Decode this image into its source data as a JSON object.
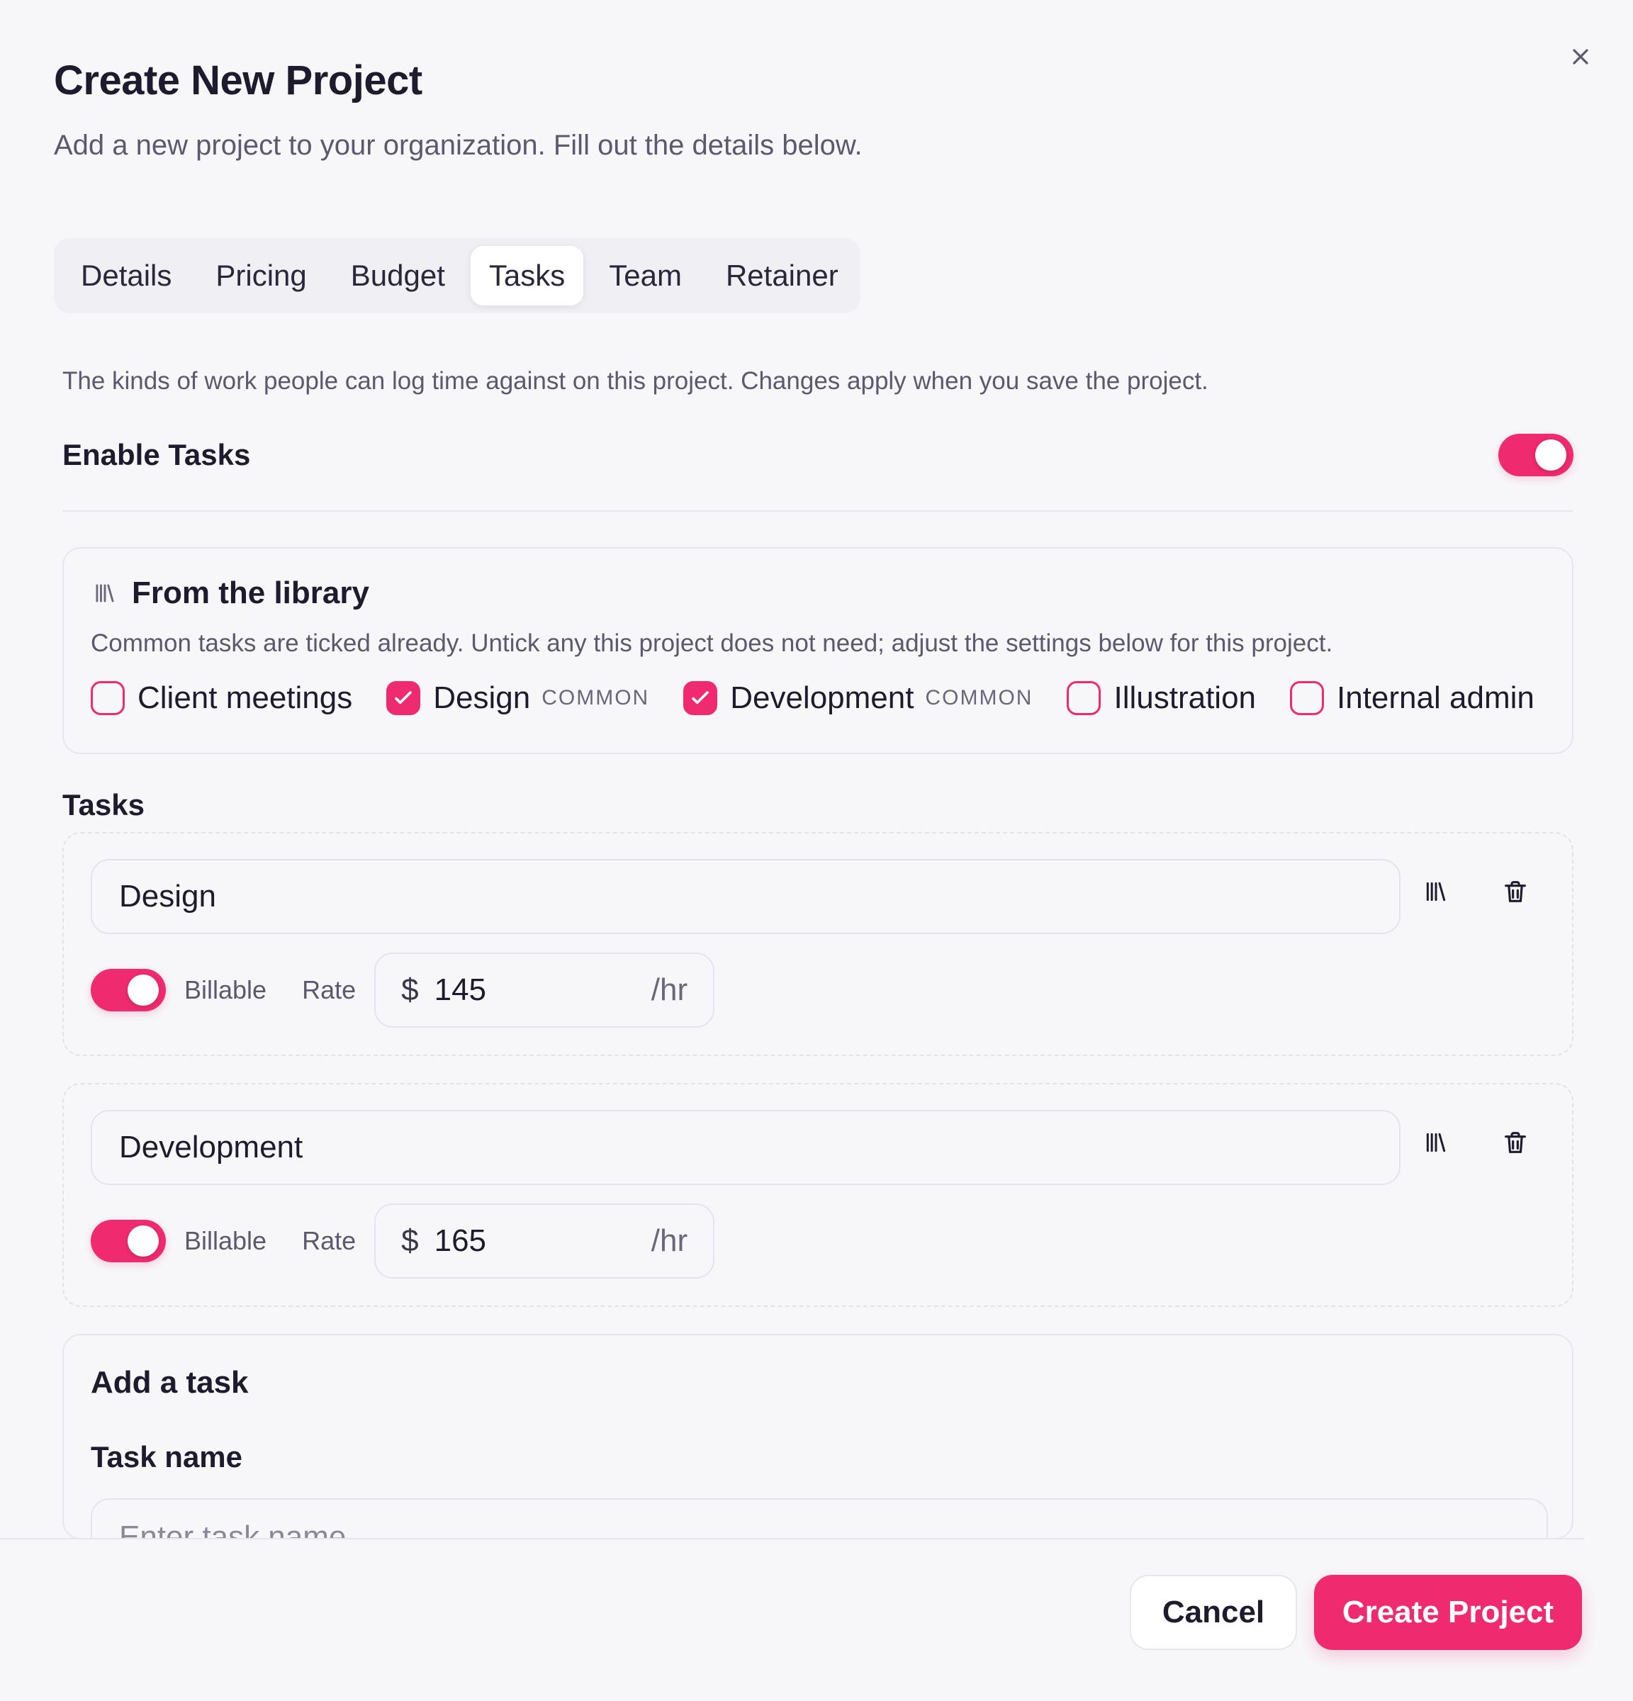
{
  "dialog": {
    "title": "Create New Project",
    "subtitle": "Add a new project to your organization. Fill out the details below.",
    "close_icon": "close-icon"
  },
  "tabs": [
    {
      "label": "Details",
      "active": false
    },
    {
      "label": "Pricing",
      "active": false
    },
    {
      "label": "Budget",
      "active": false
    },
    {
      "label": "Tasks",
      "active": true
    },
    {
      "label": "Team",
      "active": false
    },
    {
      "label": "Retainer",
      "active": false
    }
  ],
  "tasks_tab": {
    "description": "The kinds of work people can log time against on this project. Changes apply when you save the project.",
    "enable_label": "Enable Tasks",
    "enable_on": true,
    "library": {
      "icon": "library-icon",
      "title": "From the library",
      "description": "Common tasks are ticked already. Untick any this project does not need; adjust the settings below for this project.",
      "items": [
        {
          "label": "Client meetings",
          "checked": false,
          "badge": ""
        },
        {
          "label": "Design",
          "checked": true,
          "badge": "COMMON"
        },
        {
          "label": "Development",
          "checked": true,
          "badge": "COMMON"
        },
        {
          "label": "Illustration",
          "checked": false,
          "badge": ""
        },
        {
          "label": "Internal admin",
          "checked": false,
          "badge": ""
        }
      ]
    },
    "tasks_title": "Tasks",
    "task_list": [
      {
        "name": "Design",
        "billable_label": "Billable",
        "billable_on": true,
        "rate_label": "Rate",
        "currency": "$",
        "rate_value": "145",
        "rate_unit": "/hr",
        "library_icon": "library-icon",
        "delete_icon": "trash-icon"
      },
      {
        "name": "Development",
        "billable_label": "Billable",
        "billable_on": true,
        "rate_label": "Rate",
        "currency": "$",
        "rate_value": "165",
        "rate_unit": "/hr",
        "library_icon": "library-icon",
        "delete_icon": "trash-icon"
      }
    ],
    "add_task": {
      "title": "Add a task",
      "task_name_label": "Task name",
      "task_name_placeholder": "Enter task name"
    }
  },
  "footer": {
    "cancel_label": "Cancel",
    "create_label": "Create Project"
  },
  "colors": {
    "accent": "#ef2a6e",
    "text": "#1f1b2e",
    "muted": "#5b5870",
    "background": "#f7f7f9"
  }
}
